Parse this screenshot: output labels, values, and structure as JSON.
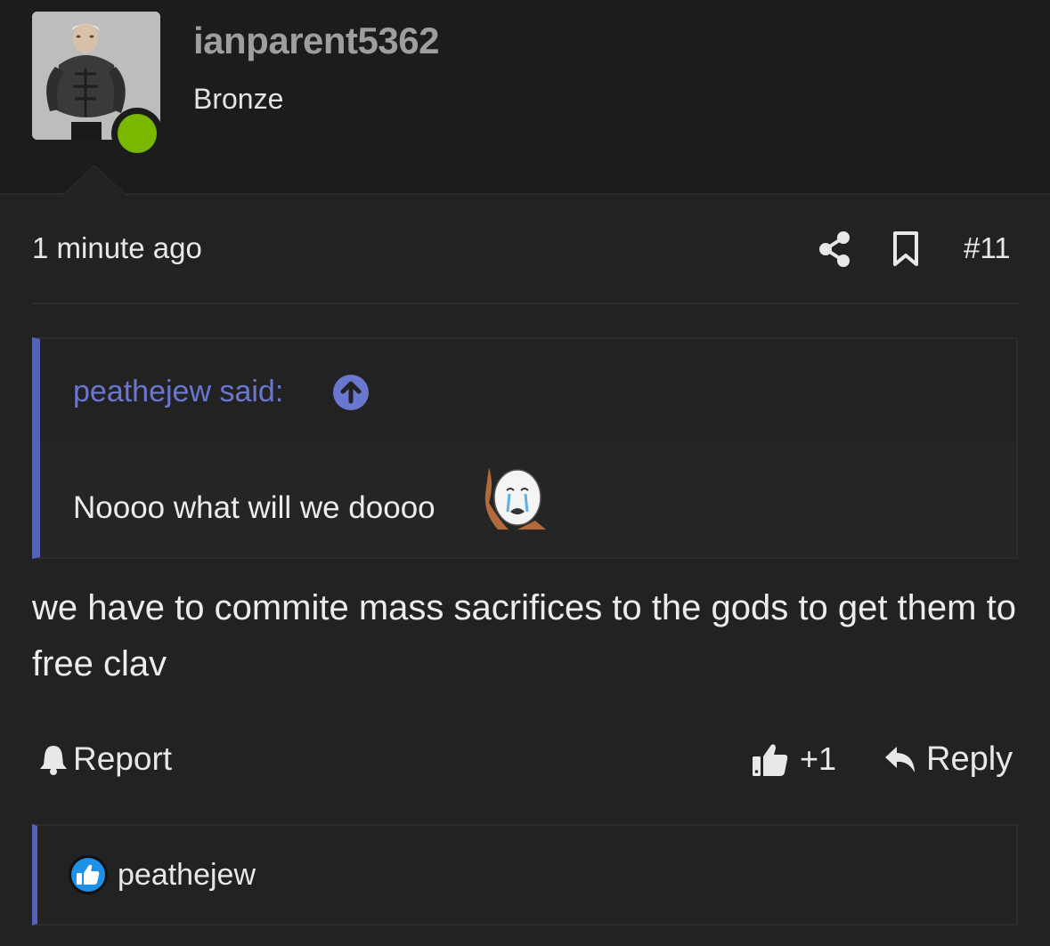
{
  "user": {
    "username": "ianparent5362",
    "title": "Bronze",
    "online_color": "#7ab800",
    "avatar_icon": "avatar-image"
  },
  "post": {
    "timestamp": "1 minute ago",
    "post_number": "#11",
    "share_icon": "share-icon",
    "bookmark_icon": "bookmark-icon",
    "body": "we have to commite mass sacrifices to the gods to get them to free clav"
  },
  "quote": {
    "author_label": "peathejew said:",
    "text": "Noooo what will we doooo",
    "accent_color": "#5562b6",
    "emoji": "crying-wojak-emoji"
  },
  "actions": {
    "report_label": "Report",
    "like_label": "+1",
    "reply_label": "Reply"
  },
  "reactions": {
    "icon": "like-reaction-icon",
    "users": "peathejew"
  }
}
